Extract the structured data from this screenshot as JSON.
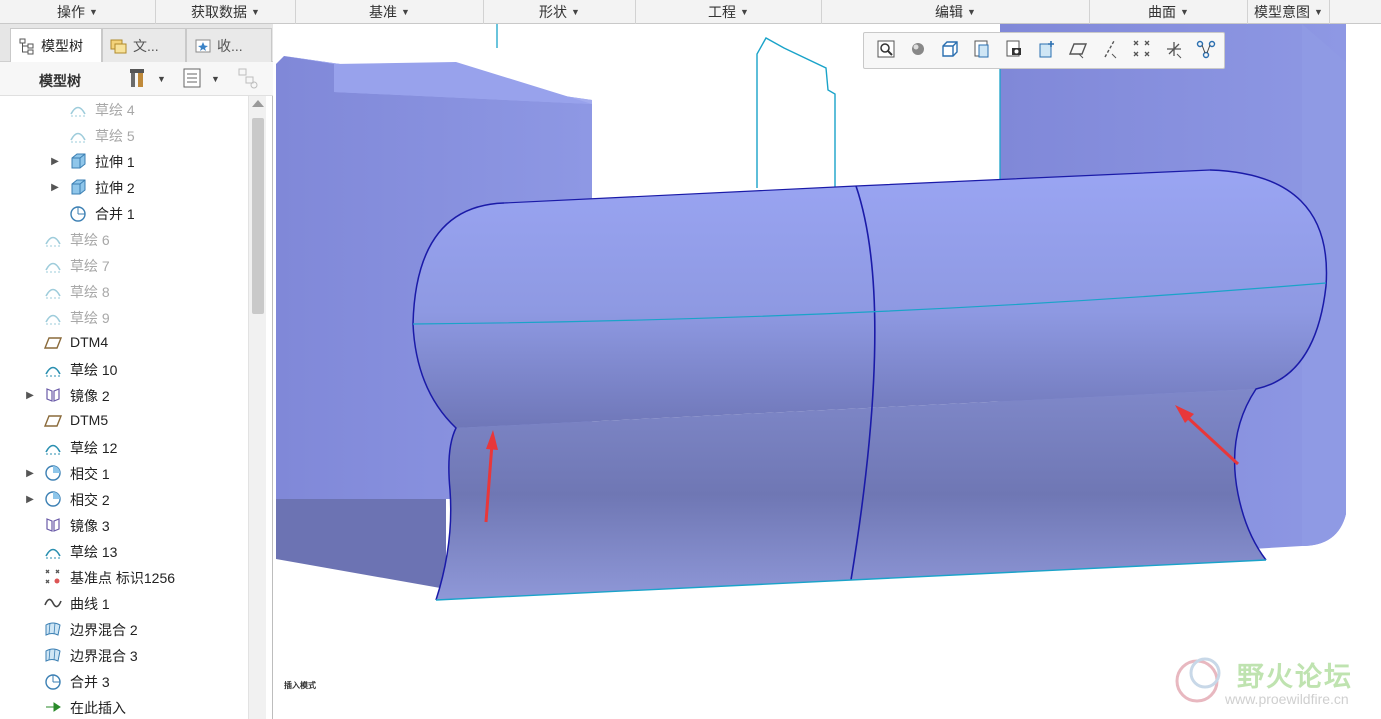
{
  "ribbon": {
    "groups": [
      {
        "label": "操作",
        "arrow": "▼"
      },
      {
        "label": "获取数据",
        "arrow": "▼"
      },
      {
        "label": "基准",
        "arrow": "▼"
      },
      {
        "label": "形状",
        "arrow": "▼"
      },
      {
        "label": "工程",
        "arrow": "▼"
      },
      {
        "label": "编辑",
        "arrow": "▼"
      },
      {
        "label": "曲面",
        "arrow": "▼"
      },
      {
        "label": "模型意图",
        "arrow": "▼"
      }
    ]
  },
  "panel": {
    "tabs": [
      {
        "label": "模型树",
        "icon": "model-tree-icon"
      },
      {
        "label": "文...",
        "icon": "folder-browser-icon"
      },
      {
        "label": "收...",
        "icon": "favorites-icon"
      }
    ],
    "tree_title": "模型树",
    "tree_items": [
      {
        "label": "草绘 4",
        "icon": "sketch-icon",
        "dim": true,
        "expandable": false
      },
      {
        "label": "草绘 5",
        "icon": "sketch-icon",
        "dim": true,
        "expandable": false
      },
      {
        "label": "拉伸 1",
        "icon": "extrude-icon",
        "dim": false,
        "expandable": true
      },
      {
        "label": "拉伸 2",
        "icon": "extrude-icon",
        "dim": false,
        "expandable": true
      },
      {
        "label": "合并 1",
        "icon": "merge-icon",
        "dim": false,
        "expandable": false
      },
      {
        "label": "草绘 6",
        "icon": "sketch-icon",
        "dim": true,
        "expandable": false
      },
      {
        "label": "草绘 7",
        "icon": "sketch-icon",
        "dim": true,
        "expandable": false
      },
      {
        "label": "草绘 8",
        "icon": "sketch-icon",
        "dim": true,
        "expandable": false
      },
      {
        "label": "草绘 9",
        "icon": "sketch-icon",
        "dim": true,
        "expandable": false
      },
      {
        "label": "DTM4",
        "icon": "datum-plane-icon",
        "dim": false,
        "expandable": false
      },
      {
        "label": "草绘 10",
        "icon": "sketch-icon",
        "dim": false,
        "expandable": false
      },
      {
        "label": "镜像 2",
        "icon": "mirror-icon",
        "dim": false,
        "expandable": true
      },
      {
        "label": "DTM5",
        "icon": "datum-plane-icon",
        "dim": false,
        "expandable": false
      },
      {
        "label": "草绘 12",
        "icon": "sketch-icon",
        "dim": false,
        "expandable": false
      },
      {
        "label": "相交 1",
        "icon": "intersect-icon",
        "dim": false,
        "expandable": true
      },
      {
        "label": "相交 2",
        "icon": "intersect-icon",
        "dim": false,
        "expandable": true
      },
      {
        "label": "镜像 3",
        "icon": "mirror-icon",
        "dim": false,
        "expandable": false
      },
      {
        "label": "草绘 13",
        "icon": "sketch-icon",
        "dim": false,
        "expandable": false
      },
      {
        "label": "基准点 标识1256",
        "icon": "datum-point-icon",
        "dim": false,
        "expandable": false
      },
      {
        "label": "曲线 1",
        "icon": "curve-icon",
        "dim": false,
        "expandable": false
      },
      {
        "label": "边界混合 2",
        "icon": "boundary-blend-icon",
        "dim": false,
        "expandable": false
      },
      {
        "label": "边界混合 3",
        "icon": "boundary-blend-icon",
        "dim": false,
        "expandable": false
      },
      {
        "label": "合并 3",
        "icon": "merge-icon",
        "dim": false,
        "expandable": false
      },
      {
        "label": "在此插入",
        "icon": "insert-here-icon",
        "dim": false,
        "expandable": false
      }
    ]
  },
  "viewport": {
    "mode_label": "插入模式",
    "toolbar_icons": [
      "refit-icon",
      "shading-icon",
      "display-style-icon",
      "saved-orientations-icon",
      "view-manager-icon",
      "perspective-icon",
      "datum-plane-display-icon",
      "datum-axis-display-icon",
      "datum-point-display-icon",
      "csys-display-icon",
      "annotation-display-icon"
    ],
    "colors": {
      "surface": "#8f9ae6",
      "edge_blue": "#1a1aa8",
      "edge_cyan": "#1aa3c9",
      "arrow": "#e8373a"
    }
  },
  "watermark": {
    "title": "野火论坛",
    "url": "www.proewildfire.cn"
  }
}
